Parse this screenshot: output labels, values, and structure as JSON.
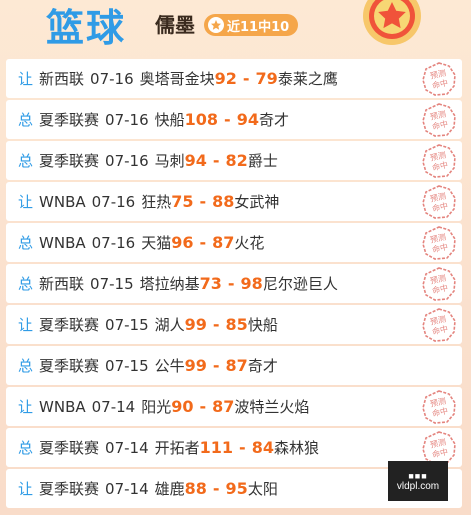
{
  "header": {
    "title": "篮球",
    "author": "儒墨",
    "badge": "近11中10"
  },
  "rows": [
    {
      "type": "让",
      "league": "新西联",
      "date": "07-16",
      "home": "奥塔哥金块",
      "home_score": "92",
      "away_score": "79",
      "away": "泰莱之鹰",
      "stamp": true
    },
    {
      "type": "总",
      "league": "夏季联赛",
      "date": "07-16",
      "home": "快船",
      "home_score": "108",
      "away_score": "94",
      "away": "奇才",
      "stamp": true
    },
    {
      "type": "总",
      "league": "夏季联赛",
      "date": "07-16",
      "home": "马刺",
      "home_score": "94",
      "away_score": "82",
      "away": "爵士",
      "stamp": true
    },
    {
      "type": "让",
      "league": "WNBA",
      "date": "07-16",
      "home": "狂热",
      "home_score": "75",
      "away_score": "88",
      "away": "女武神",
      "stamp": true
    },
    {
      "type": "总",
      "league": "WNBA",
      "date": "07-16",
      "home": "天猫",
      "home_score": "96",
      "away_score": "87",
      "away": "火花",
      "stamp": true
    },
    {
      "type": "总",
      "league": "新西联",
      "date": "07-15",
      "home": "塔拉纳基",
      "home_score": "73",
      "away_score": "98",
      "away": "尼尔逊巨人",
      "stamp": true
    },
    {
      "type": "让",
      "league": "夏季联赛",
      "date": "07-15",
      "home": "湖人",
      "home_score": "99",
      "away_score": "85",
      "away": "快船",
      "stamp": true
    },
    {
      "type": "总",
      "league": "夏季联赛",
      "date": "07-15",
      "home": "公牛",
      "home_score": "99",
      "away_score": "87",
      "away": "奇才",
      "stamp": false
    },
    {
      "type": "让",
      "league": "WNBA",
      "date": "07-14",
      "home": "阳光",
      "home_score": "90",
      "away_score": "87",
      "away": "波特兰火焰",
      "stamp": true
    },
    {
      "type": "总",
      "league": "夏季联赛",
      "date": "07-14",
      "home": "开拓者",
      "home_score": "111",
      "away_score": "84",
      "away": "森林狼",
      "stamp": true
    },
    {
      "type": "让",
      "league": "夏季联赛",
      "date": "07-14",
      "home": "雄鹿",
      "home_score": "88",
      "away_score": "95",
      "away": "太阳",
      "stamp": false
    }
  ],
  "stamp_text": [
    "预测",
    "命中"
  ],
  "watermark": {
    "top": "■■■",
    "bottom": "vldpl.com"
  },
  "colors": {
    "accent": "#2f9be6",
    "score": "#f26a1b",
    "stamp": "#e4847e",
    "badge": "#f5a64a"
  },
  "icons": {
    "badge": "star-icon",
    "medal": "medal-star-icon",
    "stamp": "hit-stamp-icon"
  }
}
